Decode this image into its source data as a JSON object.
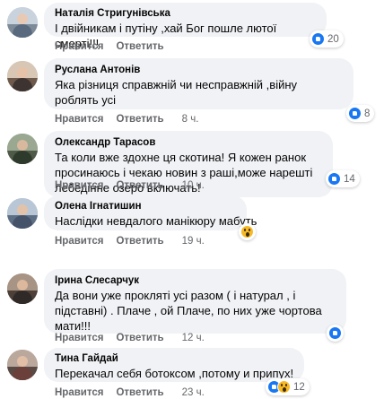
{
  "actions": {
    "like_label": "Нравится",
    "reply_label": "Ответить"
  },
  "comments": [
    {
      "author": "Наталія Стригунівська",
      "text": "І двійникам і путіну ,хай Бог пошле лютої смерті!!!",
      "time": "",
      "reactions": [
        "like-icon"
      ],
      "reaction_count": "20"
    },
    {
      "author": "Руслана Антонів",
      "text": "Яка різниця справжній чи несправжній ,війну роблять усі",
      "time": "8 ч.",
      "reactions": [
        "like-icon"
      ],
      "reaction_count": "8"
    },
    {
      "author": "Олександр Тарасов",
      "text": "Та коли вже здохне ця скотина! Я кожен ранок просинаюсь і чекаю новин з раші,може нарешті лебедінне озеро включать!",
      "time": "10 ч.",
      "reactions": [
        "like-icon"
      ],
      "reaction_count": "14"
    },
    {
      "author": "Олена Ігнатишин",
      "text": "Наслідки невдалого манікюру мабуть",
      "time": "19 ч.",
      "reactions": [
        "wow-icon"
      ],
      "reaction_count": ""
    },
    {
      "author": "Ірина Слесарчук",
      "text": "Да вони уже проклятi усi разом ( і натурал , і підставні) . Плаче , ой Плаче, по них уже чортова мати!!!",
      "time": "12 ч.",
      "reactions": [
        "like-icon"
      ],
      "reaction_count": ""
    },
    {
      "author": "Тина Гайдай",
      "text": "Перекачал себя ботоксом ,потому и припух!",
      "time": "23 ч.",
      "reactions": [
        "like-icon",
        "wow-icon"
      ],
      "reaction_count": "12"
    }
  ]
}
